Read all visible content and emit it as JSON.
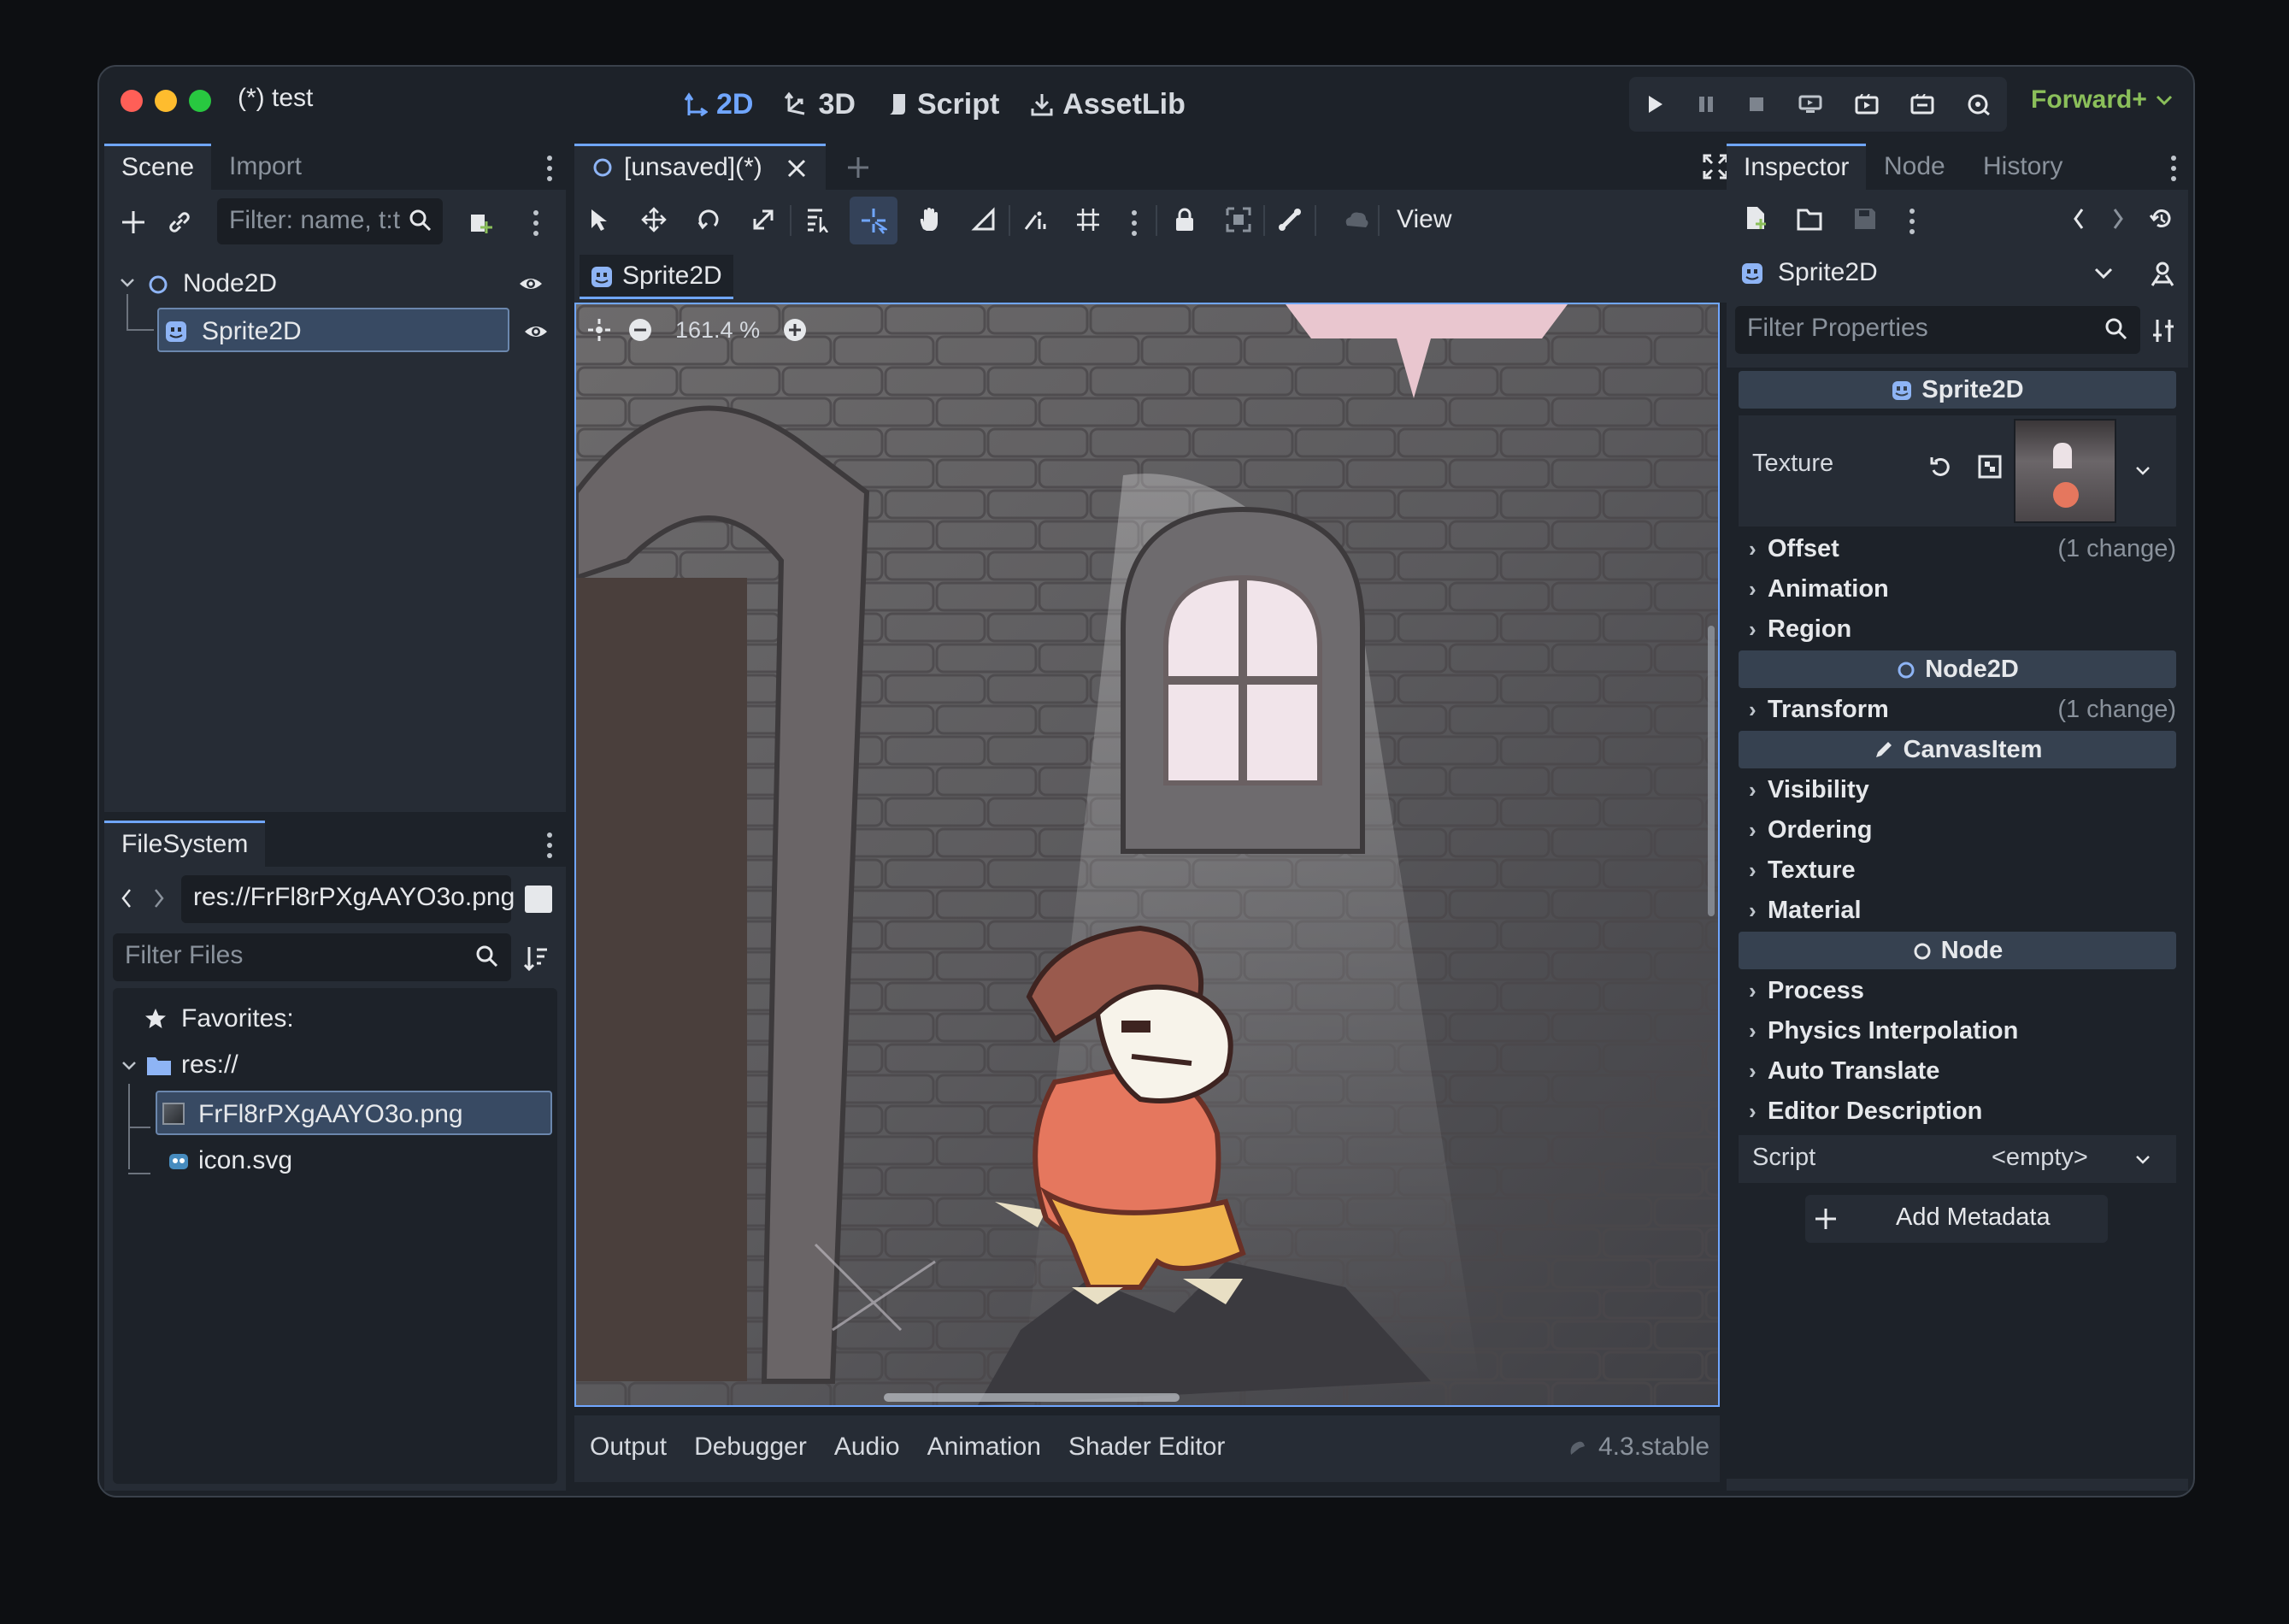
{
  "window": {
    "title": "(*) test"
  },
  "colors": {
    "accent": "#70a6ff",
    "renderer": "#8bbf5a",
    "selected": "#384a63",
    "bg": "#1d2229",
    "panel": "#262c35"
  },
  "nav": {
    "d2": "2D",
    "d3": "3D",
    "script": "Script",
    "assetlib": "AssetLib"
  },
  "renderer": "Forward+",
  "scene_dock": {
    "tabs": [
      "Scene",
      "Import"
    ],
    "filter_placeholder": "Filter: name, t:t",
    "tree": [
      {
        "label": "Node2D",
        "icon": "node2d-icon"
      },
      {
        "label": "Sprite2D",
        "icon": "sprite2d-icon"
      }
    ]
  },
  "filesystem": {
    "tab": "FileSystem",
    "path": "res://FrFl8rPXgAAYO3o.png",
    "filter_placeholder": "Filter Files",
    "favorites": "Favorites:",
    "root": "res://",
    "files": [
      "FrFl8rPXgAAYO3o.png",
      "icon.svg"
    ]
  },
  "editor": {
    "scene_tab": "[unsaved](*)",
    "node_tab": "Sprite2D",
    "view_menu": "View",
    "zoom": "161.4 %"
  },
  "bottom": {
    "tabs": [
      "Output",
      "Debugger",
      "Audio",
      "Animation",
      "Shader Editor"
    ],
    "version": "4.3.stable"
  },
  "inspector": {
    "tabs": [
      "Inspector",
      "Node",
      "History"
    ],
    "object": "Sprite2D",
    "filter_placeholder": "Filter Properties",
    "cat_sprite": "Sprite2D",
    "texture_label": "Texture",
    "offset": "Offset",
    "offset_change": "(1 change)",
    "animation": "Animation",
    "region": "Region",
    "cat_node2d": "Node2D",
    "transform": "Transform",
    "transform_change": "(1 change)",
    "cat_canvas": "CanvasItem",
    "visibility": "Visibility",
    "ordering": "Ordering",
    "texture_sec": "Texture",
    "material": "Material",
    "cat_node": "Node",
    "process": "Process",
    "physics": "Physics Interpolation",
    "autotranslate": "Auto Translate",
    "editordesc": "Editor Description",
    "script_label": "Script",
    "script_value": "<empty>",
    "add_metadata": "Add Metadata"
  }
}
